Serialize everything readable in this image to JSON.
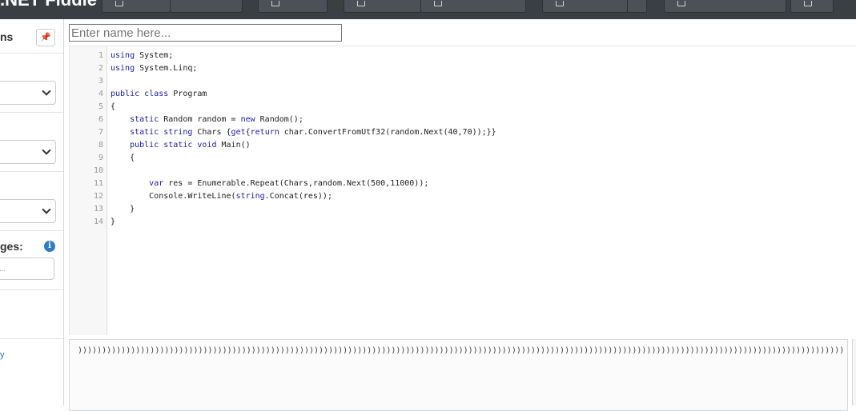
{
  "app": {
    "logo_text": ".NET Fiddle"
  },
  "sidebar": {
    "title_fragment": "ns",
    "pin_icon": "pin-icon",
    "packages_label_fragment": "ges:",
    "packages_placeholder_fragment": "...",
    "link_fragment": "y"
  },
  "name_input": {
    "placeholder": "Enter name here..."
  },
  "editor": {
    "line_numbers": [
      "1",
      "2",
      "3",
      "4",
      "5",
      "6",
      "7",
      "8",
      "9",
      "10",
      "11",
      "12",
      "13",
      "14"
    ],
    "lines": [
      "using System;",
      "using System.Linq;",
      "",
      "public class Program",
      "{",
      "    static Random random = new Random();",
      "    static string Chars {get{return char.ConvertFromUtf32(random.Next(40,70));}}",
      "    public static void Main()",
      "    {",
      "",
      "        var res = Enumerable.Repeat(Chars,random.Next(500,11000));",
      "        Console.WriteLine(string.Concat(res));",
      "    }",
      "}"
    ]
  },
  "output": {
    "text": "))))))))))))))))))))))))))))))))))))))))))))))))))))))))))))))))))))))))))))))))))))))))))))))))))))))))))))))))))))))))))))))))))))))))))))))))))))))))))))))))))))))))))))))))"
  }
}
